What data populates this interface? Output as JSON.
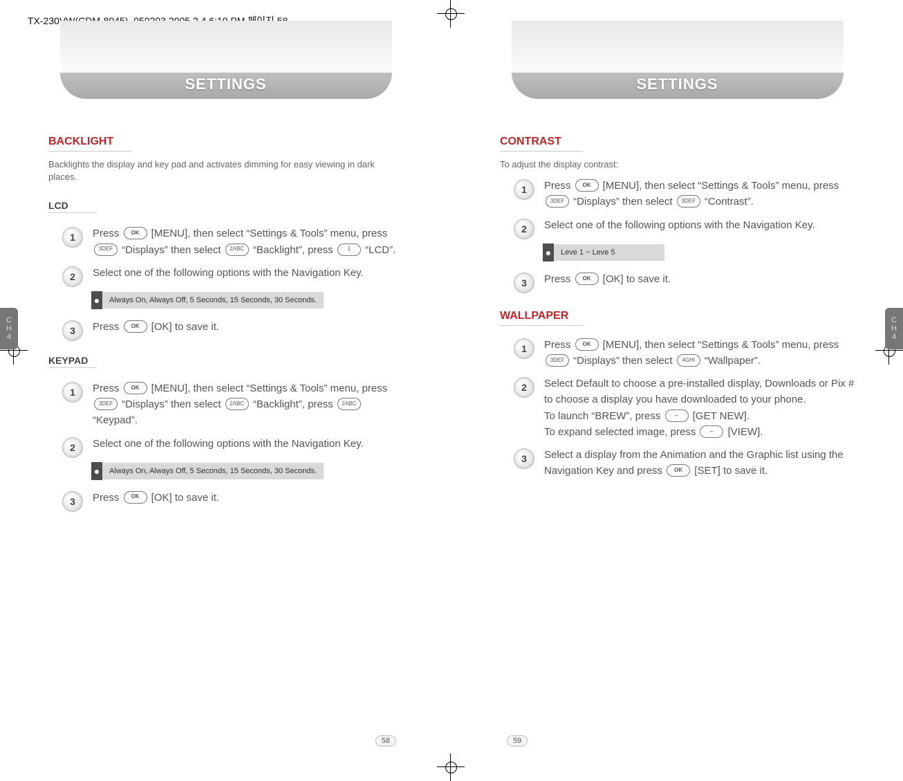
{
  "header_line": "TX-230VW(CDM-8945)_050203  2005.2.4 6:19 PM  페이지 58",
  "side_tab": {
    "line1": "C",
    "line2": "H",
    "line3": "4"
  },
  "keys": {
    "ok": "OK",
    "k1": "1",
    "k2": "2ABC",
    "k3": "3DEF",
    "k4": "4GHI",
    "soft_right": "⌐",
    "soft_left": "⌐"
  },
  "left": {
    "title": "SETTINGS",
    "page_num": "58",
    "sections": {
      "backlight": {
        "heading": "BACKLIGHT",
        "intro": "Backlights the display and key pad and activates dimming for easy viewing in dark places.",
        "lcd": {
          "sub": "LCD",
          "step1_a": "Press ",
          "step1_b": " [MENU], then select “Settings & Tools” menu, press ",
          "step1_c": " “Displays” then select ",
          "step1_d": " “Backlight”, press ",
          "step1_e": " “LCD”.",
          "step2": "Select one of the following options with the Navigation Key.",
          "note": "Always On, Always Off, 5 Seconds, 15 Seconds, 30 Seconds.",
          "step3_a": "Press ",
          "step3_b": " [OK] to save it."
        },
        "keypad": {
          "sub": "KEYPAD",
          "step1_a": "Press ",
          "step1_b": " [MENU], then select “Settings & Tools” menu, press ",
          "step1_c": " “Displays” then select ",
          "step1_d": " “Backlight”, press ",
          "step1_e": " “Keypad”.",
          "step2": "Select one of the following options with the Navigation Key.",
          "note": "Always On, Always Off, 5 Seconds, 15 Seconds, 30 Seconds.",
          "step3_a": "Press ",
          "step3_b": " [OK] to save it."
        }
      }
    }
  },
  "right": {
    "title": "SETTINGS",
    "page_num": "59",
    "sections": {
      "contrast": {
        "heading": "CONTRAST",
        "intro": "To adjust the display contrast:",
        "step1_a": "Press ",
        "step1_b": " [MENU], then select “Settings & Tools” menu, press ",
        "step1_c": " “Displays” then select ",
        "step1_d": " “Contrast”.",
        "step2": "Select one of the following options with the Navigation Key.",
        "note": "Leve 1 ~ Leve 5",
        "step3_a": "Press ",
        "step3_b": " [OK] to save it."
      },
      "wallpaper": {
        "heading": "WALLPAPER",
        "step1_a": "Press ",
        "step1_b": " [MENU], then select “Settings & Tools” menu, press ",
        "step1_c": " “Displays” then select ",
        "step1_d": " “Wallpaper”.",
        "step2_a": "Select Default to choose a pre-installed display, Downloads or Pix # to choose a display you have downloaded to your phone.",
        "step2_b": "To launch “BREW”, press ",
        "step2_c": " [GET NEW].",
        "step2_d": "To expand selected image, press ",
        "step2_e": " [VIEW].",
        "step3_a": "Select a display from the Animation and the Graphic list using the Navigation Key and press ",
        "step3_b": " [SET] to save it."
      }
    }
  },
  "nums": {
    "n1": "1",
    "n2": "2",
    "n3": "3"
  },
  "bullet": "●"
}
